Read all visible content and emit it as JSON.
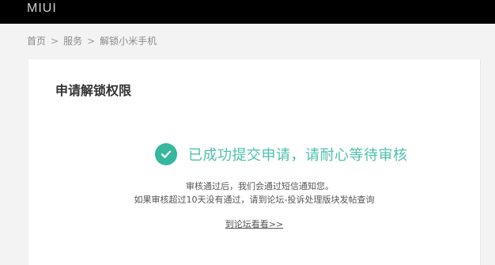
{
  "header": {
    "logo_text": "MIUI",
    "background": "#000000"
  },
  "breadcrumb": {
    "items": [
      "首页",
      "服务",
      "解锁小米手机"
    ],
    "separator": ">"
  },
  "card": {
    "title": "申请解锁权限",
    "success": {
      "icon": "check-circle-icon",
      "message": "已成功提交申请，请耐心等待审核",
      "color": "#35b89d"
    },
    "info_line1": "审核通过后，我们会通过短信通知您。",
    "info_line2": "如果审核超过10天没有通过，请到论坛-投诉处理版块发帖查询",
    "forum_link": "到论坛看看>>"
  }
}
